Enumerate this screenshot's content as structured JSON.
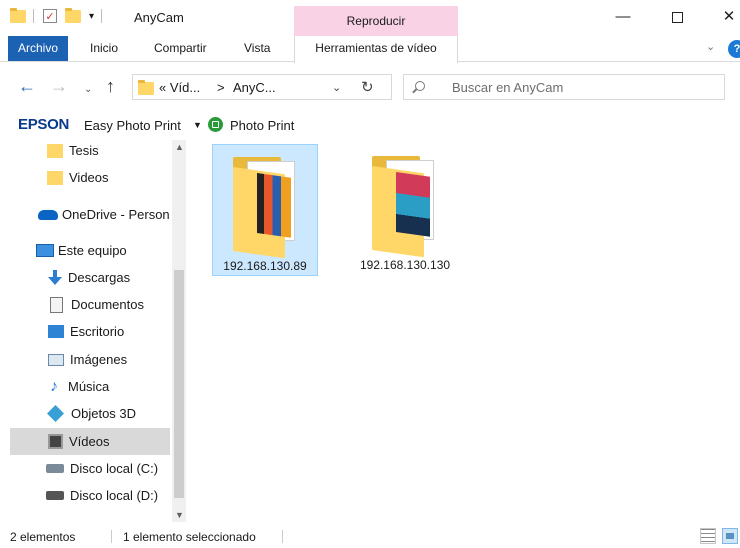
{
  "window": {
    "title": "AnyCam",
    "contextual_group": "Reproducir"
  },
  "ribbon": {
    "tabs": [
      "Archivo",
      "Inicio",
      "Compartir",
      "Vista",
      "Herramientas de vídeo"
    ]
  },
  "navigation": {
    "breadcrumb": [
      "« Víd...",
      ">",
      "AnyC..."
    ],
    "search_placeholder": "Buscar en AnyCam"
  },
  "epson_toolbar": {
    "brand": "EPSON",
    "easy_photo_print": "Easy Photo Print",
    "photo_print": "Photo Print"
  },
  "nav_pane": {
    "items": [
      {
        "label": "Tesis",
        "icon": "folder-icon"
      },
      {
        "label": "Videos",
        "icon": "folder-icon"
      },
      {
        "label": "OneDrive - Person",
        "icon": "onedrive-icon"
      },
      {
        "label": "Este equipo",
        "icon": "computer-icon"
      },
      {
        "label": "Descargas",
        "icon": "downloads-icon"
      },
      {
        "label": "Documentos",
        "icon": "documents-icon"
      },
      {
        "label": "Escritorio",
        "icon": "desktop-icon"
      },
      {
        "label": "Imágenes",
        "icon": "pictures-icon"
      },
      {
        "label": "Música",
        "icon": "music-icon"
      },
      {
        "label": "Objetos 3D",
        "icon": "3d-objects-icon"
      },
      {
        "label": "Vídeos",
        "icon": "videos-icon",
        "selected": true
      },
      {
        "label": "Disco local (C:)",
        "icon": "drive-icon"
      },
      {
        "label": "Disco local (D:)",
        "icon": "drive-icon"
      }
    ]
  },
  "files": [
    {
      "name": "192.168.130.89",
      "selected": true
    },
    {
      "name": "192.168.130.130",
      "selected": false
    }
  ],
  "status_bar": {
    "count": "2 elementos",
    "selection": "1 elemento seleccionado"
  },
  "colors": {
    "file_tab": "#1b62b3",
    "contextual_tab": "#f9d2e6",
    "selection": "#cce8ff",
    "folder": "#ffd769"
  }
}
